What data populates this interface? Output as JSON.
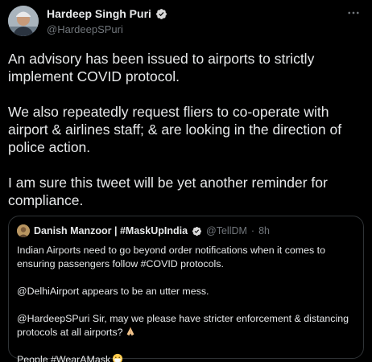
{
  "author": {
    "display_name": "Hardeep Singh Puri",
    "handle": "@HardeepSPuri",
    "verified_icon": "verified-badge-icon"
  },
  "tweet": {
    "paragraphs": [
      "An advisory has been issued to airports to strictly implement COVID protocol.",
      "We also repeatedly request fliers to co-operate with airport & airlines staff; & are looking in the direction of police action.",
      "I am sure this tweet will be yet another reminder for compliance."
    ]
  },
  "quoted_tweet": {
    "display_name": "Danish Manzoor | #MaskUpIndia",
    "handle": "@TellDM",
    "separator": "·",
    "time": "8h",
    "paragraphs": [
      "Indian Airports need to go beyond order notifications when it comes to ensuring passengers follow #COVID protocols.",
      "@DelhiAirport appears to be an utter mess.",
      "@HardeepSPuri Sir, may we please have stricter enforcement & distancing protocols at all airports?",
      "People #WearAMask"
    ],
    "emojis": [
      "folded-hands-emoji",
      "face-with-mask-emoji"
    ]
  },
  "colors": {
    "background": "#000000",
    "text": "#e7e9ea",
    "secondary_text": "#71767b",
    "border": "#2f3336",
    "verified_blue": "#1d9bf0"
  }
}
